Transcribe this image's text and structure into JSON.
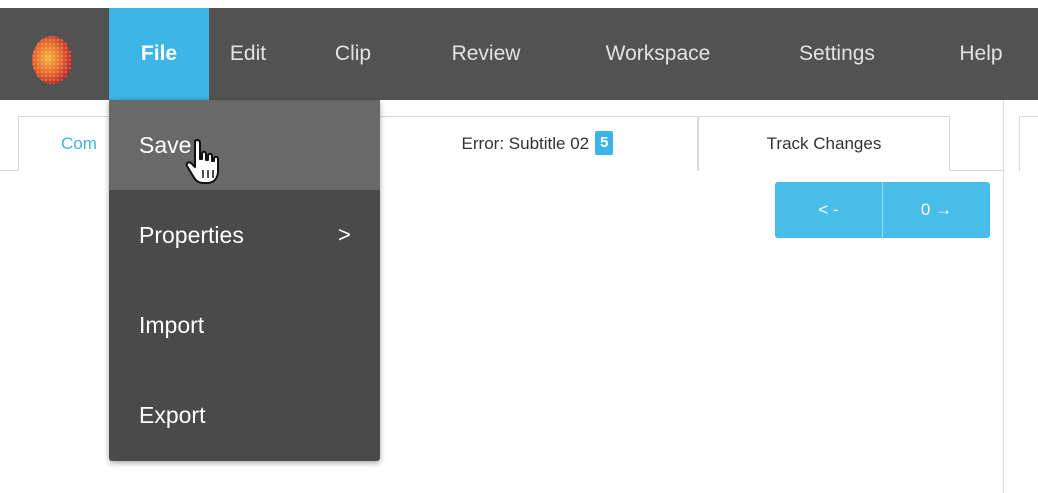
{
  "menubar": {
    "items": [
      {
        "label": "File",
        "active": true
      },
      {
        "label": "Edit"
      },
      {
        "label": "Clip"
      },
      {
        "label": "Review"
      },
      {
        "label": "Workspace"
      },
      {
        "label": "Settings"
      },
      {
        "label": "Help"
      }
    ]
  },
  "tabs": {
    "first_label": "Com",
    "error_label": "Error: Subtitle 02",
    "error_count": "5",
    "track_label": "Track Changes"
  },
  "nav": {
    "prev_label": "< -",
    "next_label": "0 →"
  },
  "file_menu": {
    "items": [
      {
        "label": "Save"
      },
      {
        "label": "Properties",
        "submenu_icon": ">"
      },
      {
        "label": "Import"
      },
      {
        "label": "Export"
      }
    ]
  },
  "colors": {
    "accent": "#3db5e6",
    "menubar_bg": "#525252",
    "dropdown_bg": "#4a4a4a",
    "dropdown_hover": "#696969"
  },
  "icons": [
    "app-logo-icon",
    "chevron-right-icon",
    "hand-pointer-cursor-icon"
  ]
}
